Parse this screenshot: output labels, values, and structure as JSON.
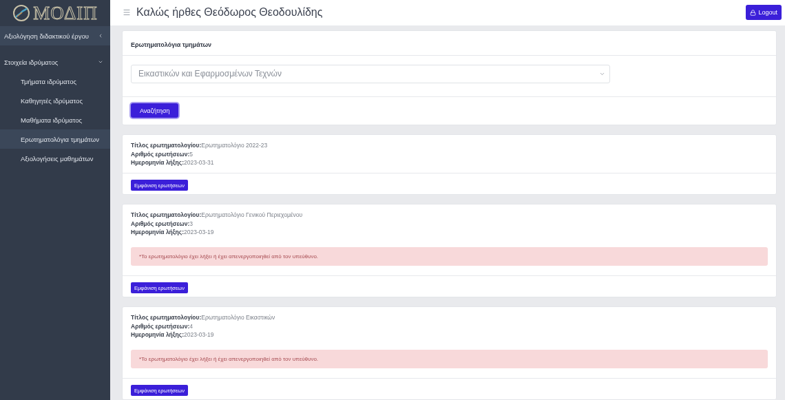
{
  "sidebar": {
    "logo": "ΜΟΔΙΠ",
    "items": [
      {
        "label": "Αξιολόγηση διδακτικού έργου",
        "expanded": false
      },
      {
        "label": "Στοιχεία ιδρύματος",
        "expanded": true,
        "children": [
          {
            "label": "Τμήματα ιδρύματος",
            "selected": false
          },
          {
            "label": "Καθηγητές ιδρύματος",
            "selected": false
          },
          {
            "label": "Μαθήματα ιδρύματος",
            "selected": false
          },
          {
            "label": "Ερωτηματολόγια τμημάτων",
            "selected": true
          },
          {
            "label": "Αξιολογήσεις μαθημάτων",
            "selected": false
          }
        ]
      }
    ]
  },
  "header": {
    "title": "Καλώς ήρθες Θεόδωρος Θεοδουλίδης",
    "logout": "Logout"
  },
  "search_card": {
    "title": "Ερωτηματολόγια τμημάτων",
    "select_value": "Εικαστικών και Εφαρμοσμένων Τεχνών",
    "button": "Αναζήτηση"
  },
  "questionnaires": [
    {
      "title_label": "Τίτλος ερωτηματολογίου:",
      "title": "Ερωτηματολόγιο 2022-23",
      "count_label": "Αριθμός ερωτήσεων:",
      "count": "5",
      "date_label": "Ημερομηνία λήξης:",
      "date": "2023-03-31",
      "button": "Εμφάνιση ερωτήσεων"
    },
    {
      "title_label": "Τίτλος ερωτηματολογίου:",
      "title": "Ερωτηματολόγιο Γενικού Περιεχομένου",
      "count_label": "Αριθμός ερωτήσεων:",
      "count": "3",
      "date_label": "Ημερομηνία λήξης:",
      "date": "2023-03-19",
      "notice": "*Το ερωτηματολόγιο έχει λήξει ή έχει απενεργοποιηθεί από τον υπεύθυνο.",
      "button": "Εμφάνιση ερωτήσεων"
    },
    {
      "title_label": "Τίτλος ερωτηματολογίου:",
      "title": "Ερωτηματολόγιο Εικαστικών",
      "count_label": "Αριθμός ερωτήσεων:",
      "count": "4",
      "date_label": "Ημερομηνία λήξης:",
      "date": "2023-03-19",
      "notice": "*Το ερωτηματολόγιο έχει λήξει ή έχει απενεργοποιηθεί από τον υπεύθυνο.",
      "button": "Εμφάνιση ερωτήσεων"
    }
  ]
}
